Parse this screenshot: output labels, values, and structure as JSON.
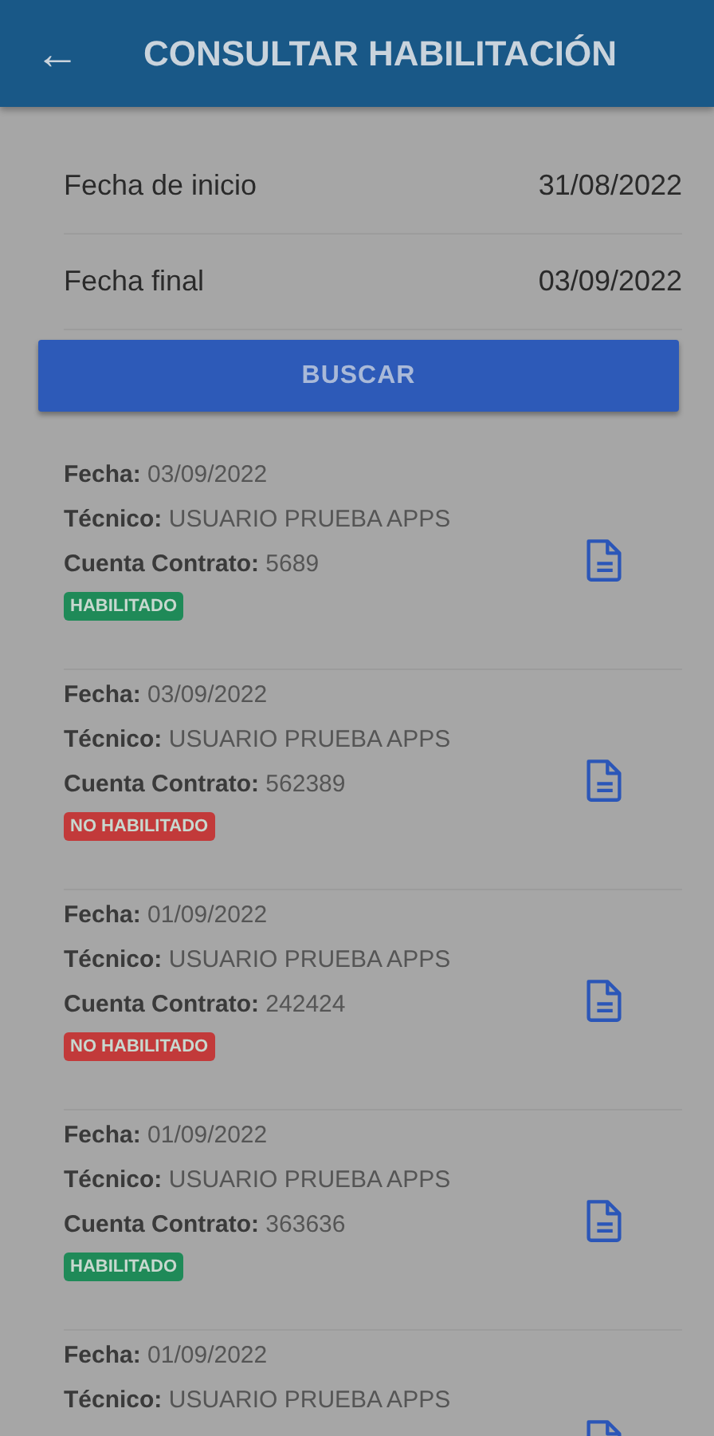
{
  "header": {
    "back_icon": "←",
    "title": "CONSULTAR HABILITACIÓN"
  },
  "filters": [
    {
      "label": "Fecha de inicio",
      "value": "31/08/2022"
    },
    {
      "label": "Fecha final",
      "value": "03/09/2022"
    }
  ],
  "search_button": "BUSCAR",
  "records": [
    {
      "fields": [
        {
          "label": "Fecha:",
          "value": "03/09/2022"
        },
        {
          "label": "Técnico:",
          "value": "USUARIO PRUEBA APPS"
        },
        {
          "label": "Cuenta Contrato:",
          "value": "5689"
        }
      ],
      "status": {
        "text": "HABILITADO",
        "kind": "enabled"
      }
    },
    {
      "fields": [
        {
          "label": "Fecha:",
          "value": "03/09/2022"
        },
        {
          "label": "Técnico:",
          "value": "USUARIO PRUEBA APPS"
        },
        {
          "label": "Cuenta Contrato:",
          "value": "562389"
        }
      ],
      "status": {
        "text": "NO HABILITADO",
        "kind": "disabled"
      }
    },
    {
      "fields": [
        {
          "label": "Fecha:",
          "value": "01/09/2022"
        },
        {
          "label": "Técnico:",
          "value": "USUARIO PRUEBA APPS"
        },
        {
          "label": "Cuenta Contrato:",
          "value": "242424"
        }
      ],
      "status": {
        "text": "NO HABILITADO",
        "kind": "disabled"
      }
    },
    {
      "fields": [
        {
          "label": "Fecha:",
          "value": "01/09/2022"
        },
        {
          "label": "Técnico:",
          "value": "USUARIO PRUEBA APPS"
        },
        {
          "label": "Cuenta Contrato:",
          "value": "363636"
        }
      ],
      "status": {
        "text": "HABILITADO",
        "kind": "enabled"
      }
    },
    {
      "fields": [
        {
          "label": "Fecha:",
          "value": "01/09/2022"
        },
        {
          "label": "Técnico:",
          "value": "USUARIO PRUEBA APPS"
        }
      ]
    }
  ]
}
